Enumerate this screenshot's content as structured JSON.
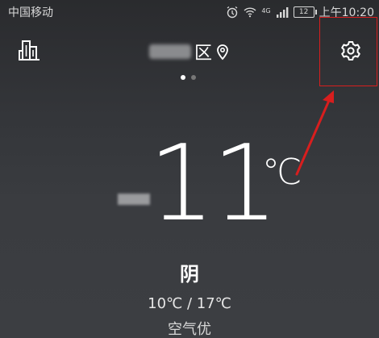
{
  "status_bar": {
    "carrier": "中国移动",
    "network": "4G",
    "battery": "12",
    "time": "上午10:20"
  },
  "header": {
    "district": "区",
    "city_icon": "city-buildings-icon",
    "location_icon": "location-pin-icon",
    "settings_icon": "gear-icon"
  },
  "pager": {
    "count": 2,
    "active": 0
  },
  "weather": {
    "temperature": "11",
    "unit": "℃",
    "condition": "阴",
    "range": "10℃ / 17℃",
    "air_quality": "空气优"
  },
  "annotation": {
    "color": "#d81e1e"
  }
}
